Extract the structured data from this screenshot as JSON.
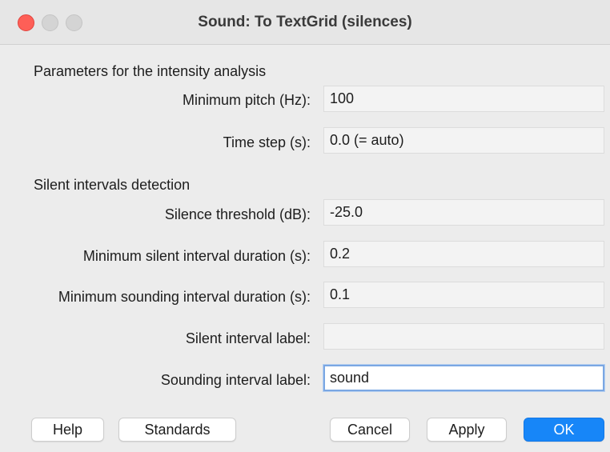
{
  "window": {
    "title": "Sound: To TextGrid (silences)"
  },
  "sections": {
    "intensity_heading": "Parameters for the intensity analysis",
    "silent_heading": "Silent intervals detection"
  },
  "fields": {
    "minimum_pitch": {
      "label": "Minimum pitch (Hz):",
      "value": "100"
    },
    "time_step": {
      "label": "Time step (s):",
      "value": "0.0 (= auto)"
    },
    "silence_threshold": {
      "label": "Silence threshold (dB):",
      "value": "-25.0"
    },
    "min_silent_duration": {
      "label": "Minimum silent interval duration (s):",
      "value": "0.2"
    },
    "min_sounding_duration": {
      "label": "Minimum sounding interval duration (s):",
      "value": "0.1"
    },
    "silent_label": {
      "label": "Silent interval label:",
      "value": ""
    },
    "sounding_label": {
      "label": "Sounding interval label:",
      "value": "sound"
    }
  },
  "buttons": {
    "help": "Help",
    "standards": "Standards",
    "cancel": "Cancel",
    "apply": "Apply",
    "ok": "OK"
  },
  "colors": {
    "close": "#fe5f57",
    "accent": "#1786f8",
    "focus_ring": "#7aa7e3"
  }
}
